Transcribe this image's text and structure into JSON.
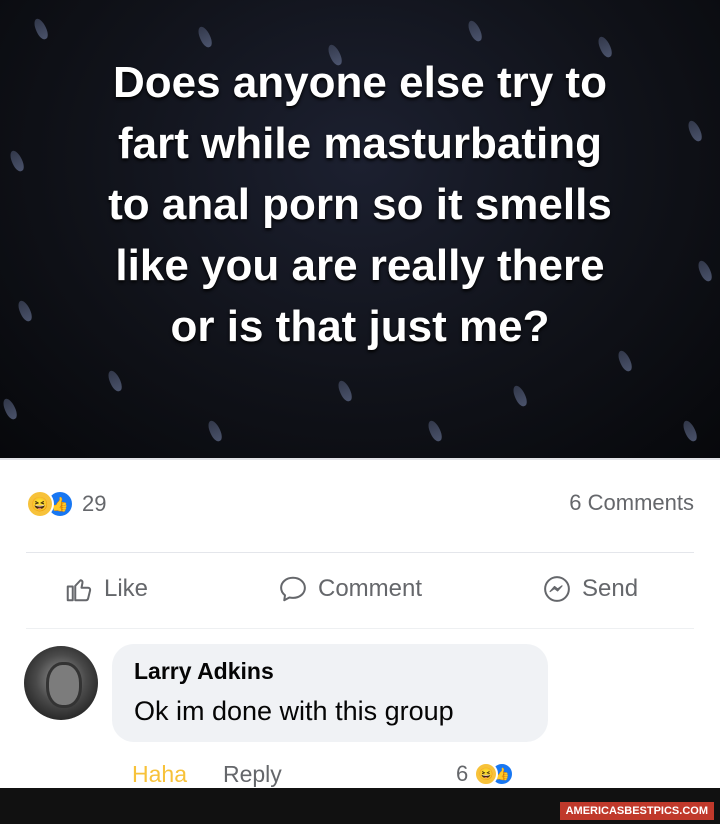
{
  "post": {
    "text": "Does anyone else try to\nfart while masturbating\nto anal porn so it smells\nlike you are really there\nor is that just me?"
  },
  "reactions": {
    "count": "29",
    "icons": [
      "haha-icon",
      "like-icon"
    ],
    "comments_label": "6 Comments"
  },
  "actions": {
    "like_label": "Like",
    "comment_label": "Comment",
    "send_label": "Send"
  },
  "comment": {
    "author": "Larry Adkins",
    "text": "Ok im done with this group",
    "haha_label": "Haha",
    "reply_label": "Reply",
    "reaction_count": "6"
  },
  "watermark": {
    "text": "AMERICASBESTPICS.COM"
  },
  "colors": {
    "haha": "#f7c23a",
    "like": "#1877f2",
    "secondary_text": "#65676b",
    "watermark_bg": "#c0392b"
  }
}
